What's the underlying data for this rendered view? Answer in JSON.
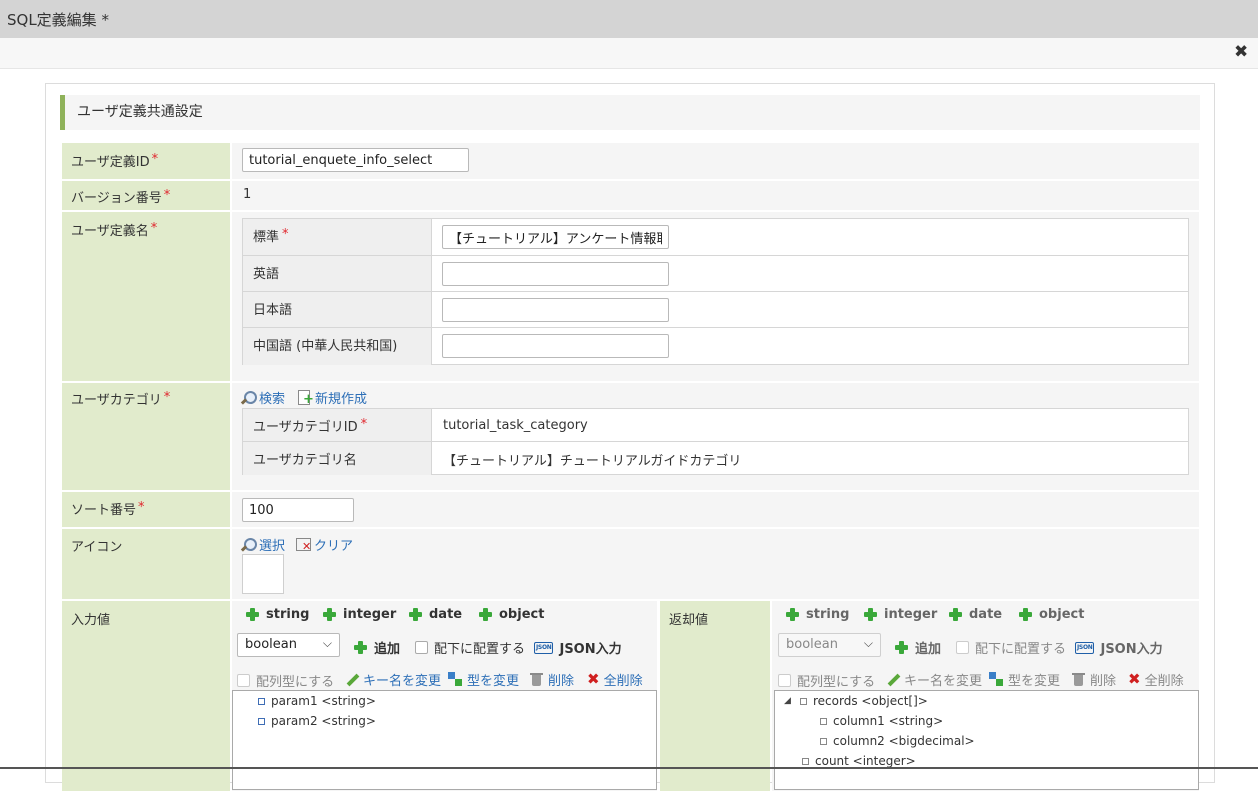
{
  "window": {
    "title": "SQL定義編集  *"
  },
  "section": {
    "title": "ユーザ定義共通設定"
  },
  "fields": {
    "user_def_id": {
      "label": "ユーザ定義ID",
      "value": "tutorial_enquete_info_select"
    },
    "version": {
      "label": "バージョン番号",
      "value": "1"
    },
    "user_def_name": {
      "label": "ユーザ定義名",
      "rows": [
        {
          "label": "標準",
          "value": "【チュートリアル】アンケート情報取得",
          "required": true
        },
        {
          "label": "英語",
          "value": ""
        },
        {
          "label": "日本語",
          "value": ""
        },
        {
          "label": "中国語 (中華人民共和国)",
          "value": ""
        }
      ]
    },
    "user_category": {
      "label": "ユーザカテゴリ",
      "search_label": "検索",
      "new_label": "新規作成",
      "id_label": "ユーザカテゴリID",
      "id_value": "tutorial_task_category",
      "name_label": "ユーザカテゴリ名",
      "name_value": "【チュートリアル】チュートリアルガイドカテゴリ"
    },
    "sort_no": {
      "label": "ソート番号",
      "value": "100"
    },
    "icon": {
      "label": "アイコン",
      "select_label": "選択",
      "clear_label": "クリア"
    }
  },
  "input_values": {
    "label": "入力値",
    "types": [
      "string",
      "integer",
      "date",
      "object"
    ],
    "selected_type": "boolean",
    "add_label": "追加",
    "place_under_label": "配下に配置する",
    "json_label": "JSON入力",
    "array_label": "配列型にする",
    "rename_label": "キー名を変更",
    "retype_label": "型を変更",
    "delete_label": "削除",
    "delete_all_label": "全削除",
    "tree": [
      {
        "text": "param1 <string>"
      },
      {
        "text": "param2 <string>"
      }
    ]
  },
  "return_values": {
    "label": "返却値",
    "types": [
      "string",
      "integer",
      "date",
      "object"
    ],
    "selected_type": "boolean",
    "add_label": "追加",
    "place_under_label": "配下に配置する",
    "json_label": "JSON入力",
    "array_label": "配列型にする",
    "rename_label": "キー名を変更",
    "retype_label": "型を変更",
    "delete_label": "削除",
    "delete_all_label": "全削除",
    "tree": [
      {
        "text": "records <object[]>"
      },
      {
        "text": "column1 <string>"
      },
      {
        "text": "column2 <bigdecimal>"
      },
      {
        "text": "count <integer>"
      }
    ]
  },
  "required_mark": "*",
  "colors": {
    "label_bg": "#e1ebcc",
    "accent": "#8fb25a",
    "link": "#2d6fb7",
    "required": "#e0262d"
  }
}
